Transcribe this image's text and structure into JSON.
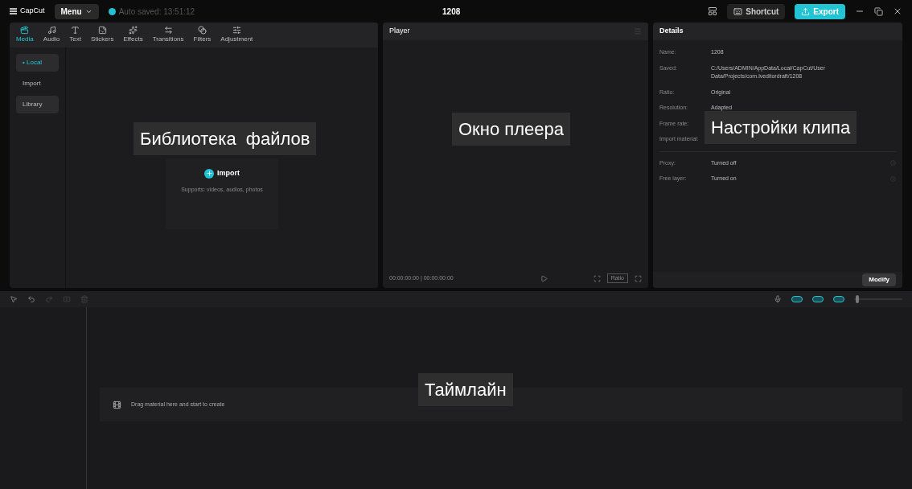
{
  "titlebar": {
    "app_name": "CapCut",
    "menu": "Menu",
    "autosave": "Auto saved: 13:51:12",
    "project_title": "1208",
    "shortcut": "Shortcut",
    "export": "Export"
  },
  "media_tabs": [
    {
      "label": "Media",
      "selected": true,
      "kind": "media"
    },
    {
      "label": "Audio",
      "selected": false,
      "kind": "audio"
    },
    {
      "label": "Text",
      "selected": false,
      "kind": "text"
    },
    {
      "label": "Stickers",
      "selected": false,
      "kind": "stickers"
    },
    {
      "label": "Effects",
      "selected": false,
      "kind": "effects"
    },
    {
      "label": "Transitions",
      "selected": false,
      "kind": "transitions"
    },
    {
      "label": "Filters",
      "selected": false,
      "kind": "filters"
    },
    {
      "label": "Adjustment",
      "selected": false,
      "kind": "adjustment"
    }
  ],
  "sidebar": {
    "items": [
      {
        "label": "• Local",
        "selected": true
      },
      {
        "label": "Import",
        "selected": false
      },
      {
        "label": "Library",
        "selected": false
      }
    ]
  },
  "import_box": {
    "button": "Import",
    "hint": "Supports: videos, audios, photos"
  },
  "media_annotation": "Библиотека  файлов",
  "player": {
    "title": "Player",
    "timecode": "00:00:00:00 | 00:00:00:00",
    "ratio": "Ratio",
    "annotation": "Окно плеера"
  },
  "details": {
    "title": "Details",
    "fields": [
      {
        "label": "Name:",
        "value": "1208"
      },
      {
        "label": "Saved:",
        "value": "C:/Users/ADMIN/AppData/Local/CapCut/User Data/Projects/com.lveditordraft/1208"
      },
      {
        "label": "Ratio:",
        "value": "Original"
      },
      {
        "label": "Resolution:",
        "value": "Adapted"
      },
      {
        "label": "Frame rate:"
      },
      {
        "label": "Import material:"
      }
    ],
    "toggles": [
      {
        "label": "Proxy:",
        "value": "Turned off"
      },
      {
        "label": "Free layer:",
        "value": "Turned on"
      }
    ],
    "modify": "Modify",
    "annotation": "Настройки клипа"
  },
  "timeline": {
    "placeholder": "Drag material here and start to create",
    "zoom": {
      "level": 0.03
    },
    "annotation": "Таймлайн"
  }
}
